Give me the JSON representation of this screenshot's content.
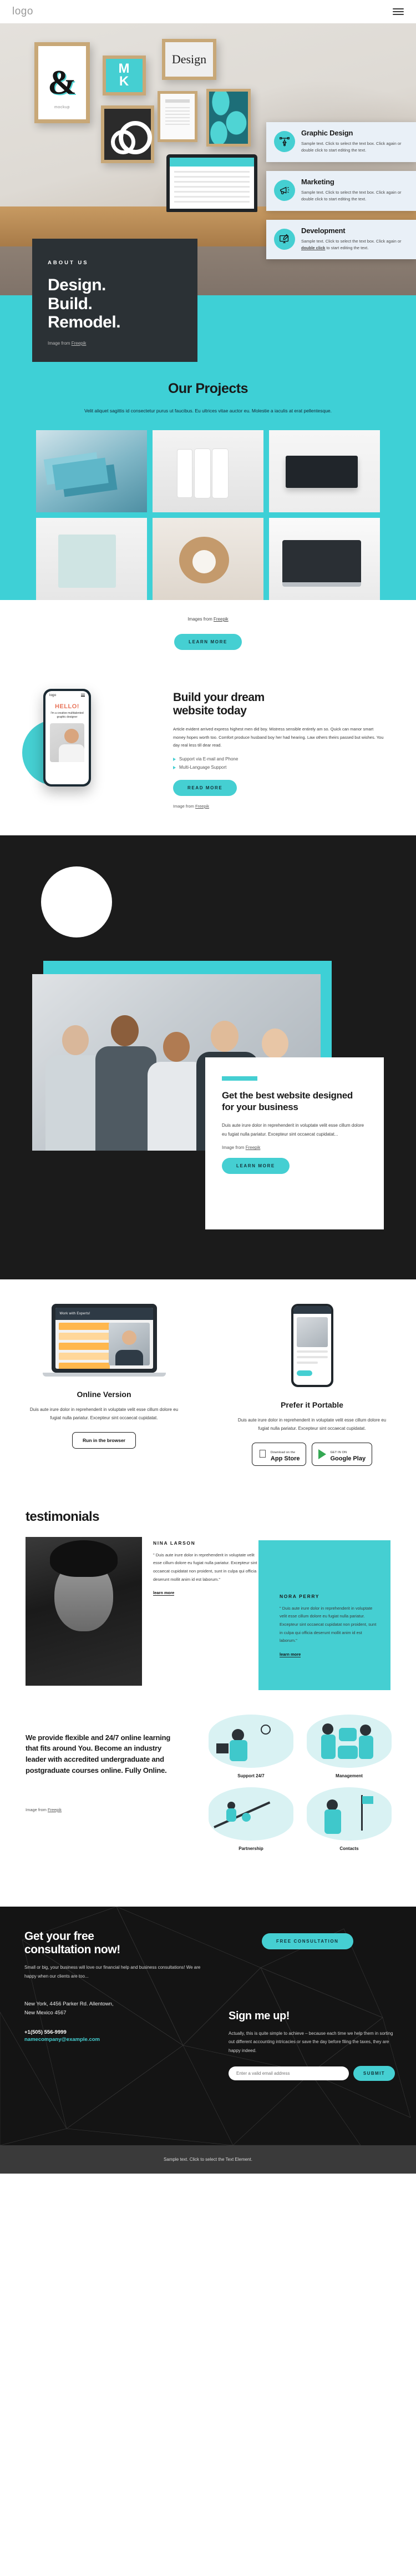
{
  "nav": {
    "logo": "logo",
    "menu_icon": "hamburger-icon"
  },
  "hero": {
    "kicker": "ABOUT US",
    "title_lines": [
      "Design.",
      "Build.",
      "Remodel."
    ],
    "credit_prefix": "Image from ",
    "credit_link": "Freepik",
    "frames": {
      "amp": "&",
      "amp_caption": "mockup",
      "mk_top": "M",
      "mk_bottom": "K",
      "design_word": "Design"
    },
    "cards": [
      {
        "icon": "pen-tool-icon",
        "title": "Graphic Design",
        "body_1": "Sample text. Click to select the text box. Click again or double click to start editing the text.",
        "body_pre": "Sample text. Click to select the text box. Click again or ",
        "body_link": "",
        "body_post": ""
      },
      {
        "icon": "megaphone-icon",
        "title": "Marketing",
        "body_1": "Sample text. Click to select the text box. Click again or double click to start editing the text.",
        "body_pre": "",
        "body_link": "",
        "body_post": ""
      },
      {
        "icon": "monitor-design-icon",
        "title": "Development",
        "body_1": "",
        "body_pre": "Sample text. Click to select the text box. Click again or ",
        "body_link": "double click",
        "body_post": " to start editing the text."
      }
    ]
  },
  "projects": {
    "title": "Our Projects",
    "subtitle": "Velit aliquet sagittis id consectetur purus ut faucibus. Eu ultrices vitae auctor eu. Molestie a iaculis at erat pellentesque.",
    "credit_prefix": "Images from ",
    "credit_link": "Freepik",
    "button": "LEARN MORE"
  },
  "build": {
    "title_lines": [
      "Build your dream",
      "website today"
    ],
    "body": "Article evident arrived express highest men did boy. Mistress sensible entirely am so. Quick can manor smart money hopes worth too. Comfort produce husband boy her had hearing. Law others theirs passed but wishes. You day real less till dear read.",
    "bullets": [
      "Support via E-mail and Phone",
      "Multi-Language Support"
    ],
    "button": "READ MORE",
    "credit_prefix": "Image from ",
    "credit_link": "Freepik",
    "phone": {
      "logo": "logo",
      "hello": "HELLO!",
      "sub": "I'm a creative multitalented graphic designer"
    }
  },
  "dark_section": {
    "title": "Get the best website designed for your business",
    "body": "Duis aute irure dolor in reprehenderit in voluptate velit esse cillum dolore eu fugiat nulla pariatur. Excepteur sint occaecat cupidatat...",
    "credit_prefix": "Image from ",
    "credit_link": "Freepik",
    "button": "LEARN MORE"
  },
  "devices": {
    "left": {
      "title": "Online Version",
      "body": "Duis aute irure dolor in reprehenderit in voluptate velit esse cillum dolore eu fugiat nulla pariatur. Excepteur sint occaecat cupidatat.",
      "button": "Run in the browser",
      "screen_label": "Work with Experts!"
    },
    "right": {
      "title": "Prefer it Portable",
      "body": "Duis aute irure dolor in reprehenderit in voluptate velit esse cillum dolore eu fugiat nulla pariatur. Excepteur sint occaecat cupidatat.",
      "appstore_small": "Download on the",
      "appstore_big": "App Store",
      "play_small": "GET IN ON",
      "play_big": "Google Play"
    }
  },
  "testimonials": {
    "heading": "testimonials",
    "items": [
      {
        "name": "NINA LARSON",
        "quote": "\" Duis aute irure dolor in reprehenderit in voluptate velit esse cillum dolore eu fugiat nulla pariatur. Excepteur sint occaecat cupidatat non proident, sunt in culpa qui officia deserunt mollit anim id est laborum.\"",
        "link": "learn more"
      },
      {
        "name": "NORA PERRY",
        "quote": "\" Duis aute irure dolor in reprehenderit in voluptate velit esse cillum dolore eu fugiat nulla pariatur. Excepteur sint occaecat cupidatat non proident, sunt in culpa qui officia deserunt mollit anim id est laborum.\"",
        "link": "learn more"
      }
    ]
  },
  "learning": {
    "heading": "We provide flexible and 24/7 online learning that fits around You. Become an industry leader with accredited undergraduate and postgraduate courses online. Fully Online.",
    "credit_prefix": "Image from ",
    "credit_link": "Freepik",
    "tiles": [
      {
        "label": "Support 24/7",
        "icon": "headset-support-illustration"
      },
      {
        "label": "Management",
        "icon": "folders-management-illustration"
      },
      {
        "label": "Partnership",
        "icon": "growth-arrow-illustration"
      },
      {
        "label": "Contacts",
        "icon": "flags-path-illustration"
      }
    ]
  },
  "footer": {
    "title_lines": [
      "Get your free",
      "consultation now!"
    ],
    "body": "Small or big, your business will love our financial help and business consultations! We are happy when our clients are too...",
    "address_lines": [
      "New York, 4456 Parker Rd. Allentown,",
      "New Mexico 4567"
    ],
    "phone": "+1(505) 556-9999",
    "email": "namecompany@example.com",
    "cta_button": "FREE CONSULTATION",
    "signup_title": "Sign me up!",
    "signup_body": "Actually, this is quite simple to achieve – because each time we help them in sorting out different accounting intricacies or save the day before filing the taxes, they are happy indeed.",
    "email_placeholder": "Enter a valid email address",
    "submit_button": "SUBMIT",
    "bottom_text": "Sample text. Click to select the Text Element.",
    "accent_color": "#45cfd2"
  }
}
